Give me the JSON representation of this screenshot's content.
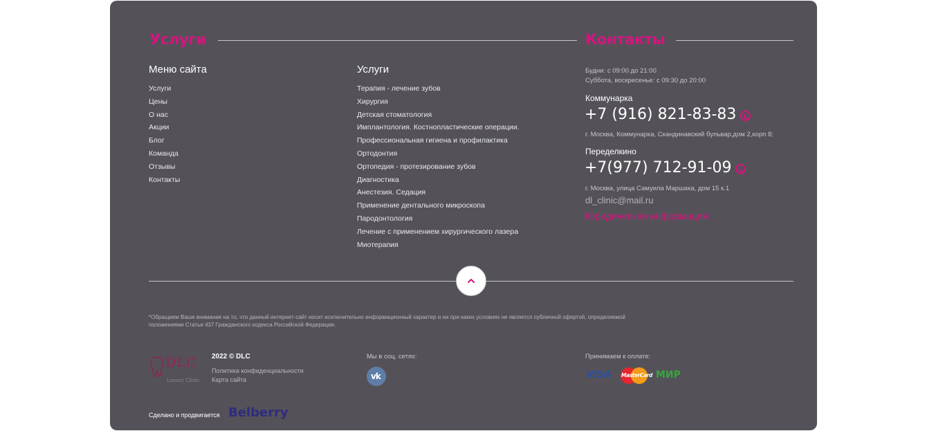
{
  "services_title": "Услуги",
  "contacts_title": "Контакты",
  "menu": {
    "heading": "Меню сайта",
    "items": [
      "Услуги",
      "Цены",
      "О нас",
      "Акции",
      "Блог",
      "Команда",
      "Отзывы",
      "Контакты"
    ]
  },
  "services": {
    "heading": "Услуги",
    "items": [
      "Терапия - лечение зубов",
      "Хирургия",
      "Детская стоматология",
      "Имплантология. Костнопластические операции.",
      "Профессиональная гигиена и профилактика",
      "Ортодонтия",
      "Ортопедия - протезирование зубов",
      "Диагностика",
      "Анестезия. Седация",
      "Применение дентального микроскопа",
      "Пародонтология",
      "Лечение с применением хирургического лазера",
      "Миотерапия"
    ]
  },
  "contacts": {
    "hours_weekdays": "Будни: с 09:00 до 21:00",
    "hours_weekend": "Суббота, воскресенье: с 09:30 до 20:00",
    "branch1_name": "Коммунарка",
    "branch1_phone": "+7 (916) 821-83-83",
    "branch1_address": "г. Москва, Коммунарка, Скандинавский бульвар,дом 2,корп 8;",
    "branch2_name": "Переделкино",
    "branch2_phone": "+7(977) 712-91-09",
    "branch2_address": "г. Москва, улица Самуила Маршака, дом 15 к.1",
    "email": "dl_clinic@mail.ru",
    "legal_link": "Юридическая информация"
  },
  "disclaimer_line1": "*Обращаем Ваше внимание на то, что данный интернет-сайт носит исключительно информационный характер и ни при каких условиях не является публичной офертой, определяемой",
  "disclaimer_line2": "положениями Статьи 437 Гражданского кодекса Российской Федерации.",
  "logo_text": "DLC",
  "logo_subtext": "Luxury Clinic",
  "copyright": "2022 © DLC",
  "privacy_link": "Политика конфиденциальности",
  "sitemap_link": "Карта сайта",
  "social_label": "Мы в соц. сетях:",
  "social_vk": "vk",
  "payment_label": "Принимаем к оплате:",
  "payments": [
    "VISA",
    "MasterCard",
    "МИР"
  ],
  "made_by_label": "Сделано и продвигается",
  "made_by_brand": "Belberry",
  "colors": {
    "accent": "#d6147f",
    "background": "#545258"
  },
  "icons": {
    "scroll_up": "chevron-up-icon",
    "whatsapp": "whatsapp-icon"
  }
}
